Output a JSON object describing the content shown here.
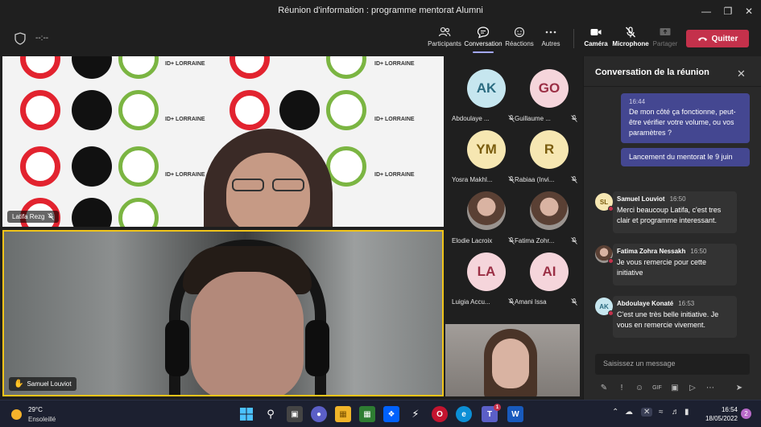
{
  "window": {
    "title": "Réunion d'information : programme mentorat Alumni"
  },
  "toolbar": {
    "timer": "--:--",
    "participants_label": "Participants",
    "conversation_label": "Conversation",
    "reactions_label": "Réactions",
    "more_label": "Autres",
    "camera_label": "Caméra",
    "microphone_label": "Microphone",
    "share_label": "Partager",
    "quit_label": "Quitter"
  },
  "videos": {
    "main_speaker": "Latifa Rezg",
    "second_speaker": "Samuel Louviot",
    "logo_text": "ID+ LORRAINE"
  },
  "participants": [
    {
      "initials": "AK",
      "name": "Abdoulaye ...",
      "bg": "#c6e6ef",
      "fg": "#2b6b80"
    },
    {
      "initials": "GO",
      "name": "Guillaume ...",
      "bg": "#f5d5db",
      "fg": "#9b2f45"
    },
    {
      "initials": "YM",
      "name": "Yosra Makhl...",
      "bg": "#f6e7b2",
      "fg": "#7a5d0e"
    },
    {
      "initials": "R",
      "name": "Rabiaa (Invi...",
      "bg": "#f6e7b2",
      "fg": "#7a5d0e"
    },
    {
      "initials": "",
      "name": "Elodie Lacroix",
      "bg": "#8c8c8c",
      "fg": "#fff"
    },
    {
      "initials": "",
      "name": "Fatima Zohr...",
      "bg": "#6b6b6b",
      "fg": "#fff"
    },
    {
      "initials": "LA",
      "name": "Luigia Accu...",
      "bg": "#f5d5db",
      "fg": "#9b2f45"
    },
    {
      "initials": "AI",
      "name": "Amani Issa",
      "bg": "#f5d5db",
      "fg": "#9b2f45"
    }
  ],
  "chat": {
    "title": "Conversation de la réunion",
    "self_time": "16:44",
    "self_msg1": "De mon côté ça fonctionne, peut-être vérifier votre volume, ou vos paramètres ?",
    "self_msg2": "Lancement du mentorat le 9 juin",
    "messages": [
      {
        "initials": "SL",
        "name": "Samuel Louviot",
        "time": "16:50",
        "text": "Merci beaucoup Latifa, c'est tres clair et programme interessant."
      },
      {
        "initials": "",
        "name": "Fatima Zohra Nessakh",
        "time": "16:50",
        "text": "Je vous remercie pour cette initiative"
      },
      {
        "initials": "AK",
        "name": "Abdoulaye Konaté",
        "time": "16:53",
        "text": "C'est une très belle initiative. Je vous en remercie vivement."
      }
    ],
    "input_placeholder": "Saisissez un message"
  },
  "taskbar": {
    "temperature": "29°C",
    "weather": "Ensoleillé",
    "time": "16:54",
    "date": "18/05/2022",
    "notification_count": "2",
    "teams_badge": "1"
  },
  "colors": {
    "accent": "#444791",
    "quit": "#c4314b",
    "speaker_border": "#f0c419"
  }
}
